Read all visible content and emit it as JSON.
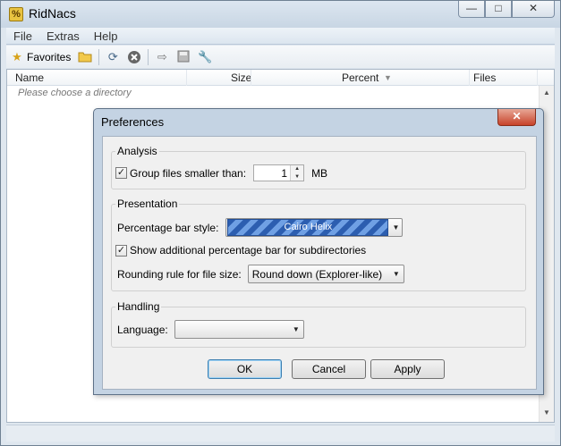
{
  "window": {
    "title": "RidNacs",
    "app_icon": "%",
    "buttons": {
      "minimize": "—",
      "maximize": "□",
      "close": "✕"
    }
  },
  "menu": [
    "File",
    "Extras",
    "Help"
  ],
  "toolbar": {
    "favorites_label": "Favorites",
    "icons": [
      "star-folder-icon",
      "open-folder-icon",
      "refresh-icon",
      "stop-icon",
      "export-icon",
      "save-icon",
      "wrench-icon"
    ]
  },
  "list": {
    "columns": [
      "Name",
      "Size",
      "Percent",
      "Files"
    ],
    "sort_indicator": "▼",
    "empty_text": "Please choose a directory"
  },
  "dialog": {
    "title": "Preferences",
    "close": "✕",
    "analysis": {
      "group": "Analysis",
      "group_files_label": "Group files smaller than:",
      "group_files_checked": true,
      "group_files_value": "1",
      "unit": "MB"
    },
    "presentation": {
      "group": "Presentation",
      "bar_style_label": "Percentage bar style:",
      "bar_style_value": "Cairo Helix",
      "subdirs_label": "Show additional percentage bar for subdirectories",
      "subdirs_checked": true,
      "rounding_label": "Rounding rule for file size:",
      "rounding_value": "Round down (Explorer-like)"
    },
    "handling": {
      "group": "Handling",
      "language_label": "Language:",
      "language_value": ""
    },
    "buttons": {
      "ok": "OK",
      "cancel": "Cancel",
      "apply": "Apply"
    }
  },
  "colors": {
    "accent": "#3c7fb1",
    "close_red": "#c7432a",
    "helix_blue": "#2c5eb0"
  }
}
